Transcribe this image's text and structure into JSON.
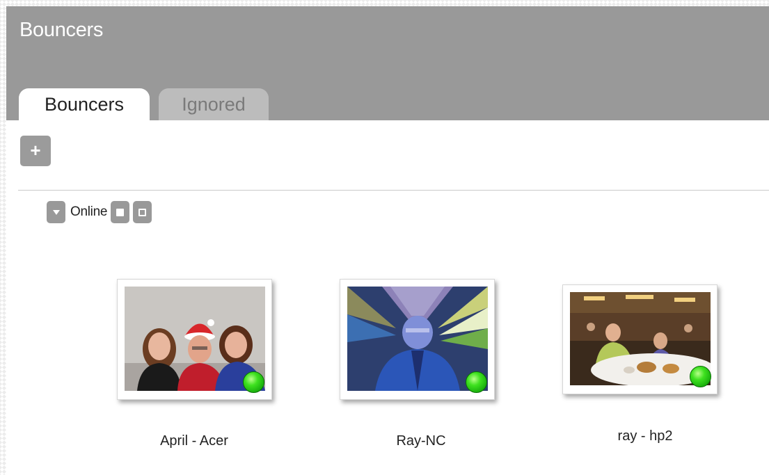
{
  "header": {
    "title": "Bouncers"
  },
  "tabs": [
    {
      "label": "Bouncers",
      "active": true
    },
    {
      "label": "Ignored",
      "active": false
    }
  ],
  "toolbar": {
    "add_label": "+"
  },
  "group": {
    "label": "Online"
  },
  "bouncers": [
    {
      "name": "April - Acer",
      "status": "online"
    },
    {
      "name": "Ray-NC",
      "status": "online"
    },
    {
      "name": "ray - hp2",
      "status": "online"
    }
  ],
  "colors": {
    "header_bg": "#999999",
    "inactive_tab_bg": "#bcbcbc",
    "status_online": "#3ee11f"
  }
}
